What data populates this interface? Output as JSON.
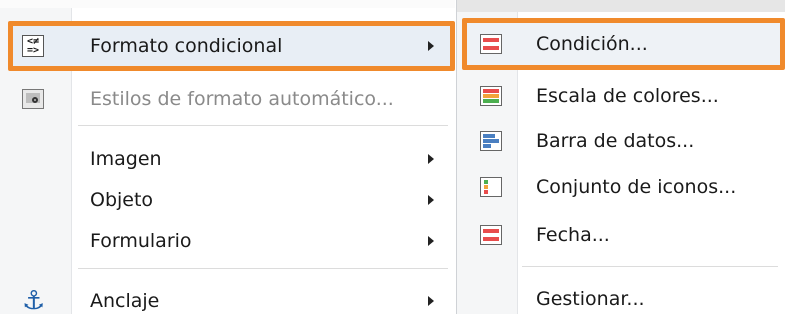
{
  "main_menu": {
    "items": [
      {
        "label": "Formato condicional",
        "icon": "conditional-format-icon",
        "has_submenu": true,
        "highlighted": true,
        "enabled": true
      },
      {
        "label": "Estilos de formato automático...",
        "icon": "autoformat-icon",
        "has_submenu": false,
        "highlighted": false,
        "enabled": false
      },
      {
        "label": "Imagen",
        "has_submenu": true,
        "enabled": true
      },
      {
        "label": "Objeto",
        "has_submenu": true,
        "enabled": true
      },
      {
        "label": "Formulario",
        "has_submenu": true,
        "enabled": true
      },
      {
        "label": "Anclaje",
        "icon": "anchor-icon",
        "has_submenu": true,
        "enabled": true
      }
    ],
    "conditional_icon_glyphs": [
      "<≠",
      "=>"
    ]
  },
  "submenu": {
    "items": [
      {
        "label": "Condición...",
        "icon": "condition-icon",
        "highlighted": true
      },
      {
        "label": "Escala de colores...",
        "icon": "color-scale-icon"
      },
      {
        "label": "Barra de datos...",
        "icon": "data-bar-icon"
      },
      {
        "label": "Conjunto de iconos...",
        "icon": "icon-set-icon"
      },
      {
        "label": "Fecha...",
        "icon": "date-icon"
      },
      {
        "label": "Gestionar...",
        "icon": ""
      }
    ]
  },
  "colors": {
    "highlight_outline": "#f08a2c",
    "anchor": "#1f5fa8",
    "red": "#e84c4c",
    "orange": "#f2a33a",
    "green": "#4caf50",
    "blue": "#4a7fc1"
  }
}
